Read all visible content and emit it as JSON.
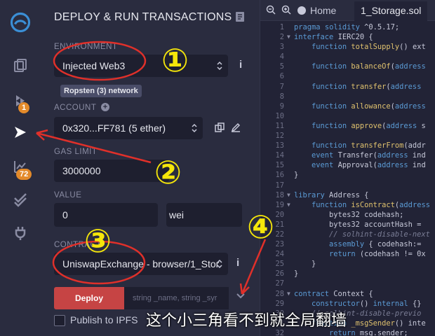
{
  "rail": {
    "badges": {
      "deploy": "1",
      "analysis": "72"
    }
  },
  "panel": {
    "title": "DEPLOY & RUN TRANSACTIONS",
    "environment_label": "ENVIRONMENT",
    "environment_value": "Injected Web3",
    "network_tag": "Ropsten (3) network",
    "account_label": "ACCOUNT",
    "account_value": "0x320...FF781 (5 ether)",
    "gas_limit_label": "GAS LIMIT",
    "gas_limit_value": "3000000",
    "value_label": "VALUE",
    "value_amount": "0",
    "value_unit": "wei",
    "contract_label": "CONTRACT",
    "contract_value": "UniswapExchange - browser/1_Stor",
    "deploy_label": "Deploy",
    "deploy_placeholder": "string _name, string _syr",
    "publish_label": "Publish to IPFS"
  },
  "editor": {
    "home_tab": "Home",
    "file_tab": "1_Storage.sol",
    "lines": [
      {
        "n": "1",
        "code": "pragma solidity ^0.5.17;"
      },
      {
        "n": "2",
        "code": "interface IERC20 {",
        "fold": true
      },
      {
        "n": "3",
        "code": "    function totalSupply() ext"
      },
      {
        "n": "4",
        "code": ""
      },
      {
        "n": "5",
        "code": "    function balanceOf(address"
      },
      {
        "n": "6",
        "code": ""
      },
      {
        "n": "7",
        "code": "    function transfer(address"
      },
      {
        "n": "8",
        "code": ""
      },
      {
        "n": "9",
        "code": "    function allowance(address"
      },
      {
        "n": "10",
        "code": ""
      },
      {
        "n": "11",
        "code": "    function approve(address s"
      },
      {
        "n": "12",
        "code": ""
      },
      {
        "n": "13",
        "code": "    function transferFrom(addr"
      },
      {
        "n": "14",
        "code": "    event Transfer(address ind"
      },
      {
        "n": "15",
        "code": "    event Approval(address ind"
      },
      {
        "n": "16",
        "code": "}"
      },
      {
        "n": "17",
        "code": ""
      },
      {
        "n": "18",
        "code": "library Address {",
        "fold": true
      },
      {
        "n": "19",
        "code": "    function isContract(address",
        "fold": true
      },
      {
        "n": "20",
        "code": "        bytes32 codehash;"
      },
      {
        "n": "21",
        "code": "        bytes32 accountHash = "
      },
      {
        "n": "22",
        "code": "        // solhint-disable-next",
        "comment": true
      },
      {
        "n": "23",
        "code": "        assembly { codehash:="
      },
      {
        "n": "24",
        "code": "        return (codehash != 0x"
      },
      {
        "n": "25",
        "code": "    }"
      },
      {
        "n": "26",
        "code": "}"
      },
      {
        "n": "27",
        "code": ""
      },
      {
        "n": "28",
        "code": "contract Context {",
        "fold": true
      },
      {
        "n": "29",
        "code": "    constructor() internal {}"
      },
      {
        "n": "30",
        "code": "    // solhint-disable-previo",
        "comment": true
      },
      {
        "n": "31",
        "code": "    function _msgSender() inte"
      },
      {
        "n": "32",
        "code": "        return msg.sender;"
      }
    ]
  },
  "annotations": {
    "numbers": [
      "②",
      "①",
      "③",
      "④"
    ],
    "caption": "这个小三角看不到就全局翻墙"
  },
  "colors": {
    "accent_red": "#c64444",
    "badge_orange": "#e38a2a",
    "annotation_red": "#e0302a",
    "annotation_yellow": "#f5e60a"
  }
}
